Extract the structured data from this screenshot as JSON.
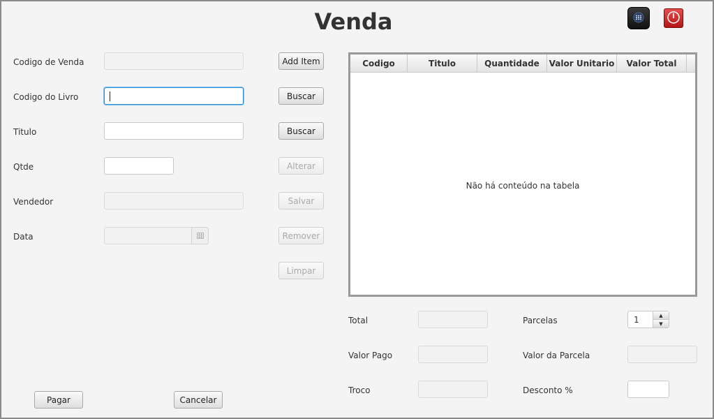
{
  "window": {
    "title": "Venda"
  },
  "toolbar": {
    "apps_icon": "apps-grid-icon",
    "power_icon": "power-icon"
  },
  "form": {
    "codigo_venda": {
      "label": "Codigo de Venda",
      "value": ""
    },
    "codigo_livro": {
      "label": "Codigo do Livro",
      "value": ""
    },
    "titulo": {
      "label": "Titulo",
      "value": ""
    },
    "qtde": {
      "label": "Qtde",
      "value": ""
    },
    "vendedor": {
      "label": "Vendedor",
      "value": ""
    },
    "data": {
      "label": "Data",
      "value": "",
      "icon": "calendar-icon"
    }
  },
  "actions": {
    "add_item": "Add Item",
    "buscar_livro": "Buscar",
    "buscar_titulo": "Buscar",
    "alterar": "Alterar",
    "salvar": "Salvar",
    "remover": "Remover",
    "limpar": "Limpar",
    "pagar": "Pagar",
    "cancelar": "Cancelar"
  },
  "table": {
    "columns": [
      "Codigo",
      "Titulo",
      "Quantidade",
      "Valor Unitario",
      "Valor Total"
    ],
    "rows": [],
    "empty_message": "Não há conteúdo na tabela"
  },
  "summary": {
    "total": {
      "label": "Total",
      "value": ""
    },
    "valor_pago": {
      "label": "Valor Pago",
      "value": ""
    },
    "troco": {
      "label": "Troco",
      "value": ""
    },
    "parcelas": {
      "label": "Parcelas",
      "value": "1"
    },
    "valor_parcela": {
      "label": "Valor da Parcela",
      "value": ""
    },
    "desconto": {
      "label": "Desconto %",
      "value": ""
    }
  },
  "colors": {
    "focus": "#2e8fd6",
    "power": "#c71d1d",
    "app_button": "#1e1e1e"
  }
}
